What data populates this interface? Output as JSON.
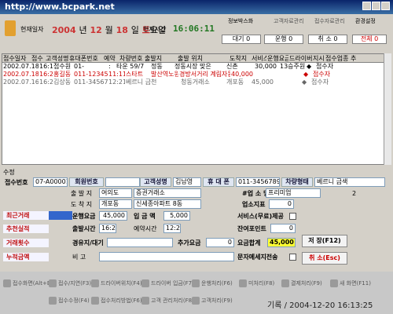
{
  "app": {
    "watermark": "http://www.bcpark.net"
  },
  "header": {
    "current_date_label": "현재일자",
    "date_y": "2004",
    "y": "년",
    "date_m": "12",
    "m": "월",
    "date_d": "18",
    "d": "일",
    "weekday": "토",
    "weekday_suffix": "요일",
    "current_time_label": "현재시간",
    "time": "16:06:11",
    "top_buttons": [
      "정보박스화",
      "고객자료관리",
      "접수자료관리",
      "환경설정"
    ],
    "counts": [
      {
        "label": "대기",
        "value": "0"
      },
      {
        "label": "운행",
        "value": "0"
      },
      {
        "label": "취 소",
        "value": "0"
      },
      {
        "label": "전체",
        "value": "0"
      }
    ]
  },
  "grid": {
    "columns": [
      "접수일자",
      "접수",
      "고객성명",
      "휴대폰번호",
      "예약",
      "차량번호",
      "출발지",
      "출발 위치",
      "도착지",
      "서비스",
      "운행요금",
      "드라이버",
      "지시",
      "접수업종 추가"
    ],
    "rows": [
      {
        "date": "2002.07.18",
        "time": "16:19",
        "person": "접수원",
        "phone": "01-",
        "reserve": "",
        "car": ":",
        "start": "타운 59/7",
        "start2": "정동",
        "location": "정동시장 맞은",
        "dest": "신촌",
        "fee": "30,000",
        "driver": "13승주원",
        "mark": "◆",
        "extra": "접수자"
      },
      {
        "date": "2002.07.18",
        "time": "16:21",
        "person": "홍길동",
        "phone": "011-1234568",
        "reserve": "11:11",
        "car": "스타트",
        "start2": "발산역노원",
        "location": "경방서거리 계림자동",
        "dest": "",
        "fee": "40,000",
        "driver": "",
        "mark": "◆",
        "extra": "접수자"
      },
      {
        "date": "2002.07.16",
        "time": "16:22",
        "person": "김상동",
        "phone": "011-3456789",
        "reserve": "12:21",
        "car": "베르니 금천",
        "start2": "",
        "location": "청동거래소",
        "dest": "개포동",
        "fee": "45,000",
        "driver": "",
        "mark": "◆",
        "extra": "접수자"
      }
    ]
  },
  "form": {
    "section_label": "수정",
    "reception_no_label": "접수번호",
    "reception_no": "07-A00001",
    "member_no_label": "회원번호",
    "customer_name_label": "고객성명",
    "customer_name": "김남영",
    "mobile_label": "휴 대 폰",
    "mobile": "011-3456789",
    "car_type_label": "차량형태",
    "car_type": "베르니 금색",
    "start_label": "출 발 지",
    "start": "여의도",
    "start_loc": "증권거래소",
    "dest_label": "도 착 지",
    "dest": "개포동",
    "dest_loc": "신세종아파트 8동",
    "dispatch_label": "#업 소 명",
    "dispatch": "프리미엄",
    "count_value": "2",
    "driver_label": "오도원",
    "extra_label": "업소지표",
    "extra_value": "0",
    "fare_label": "운행요금",
    "fare": "45,000",
    "deposit_label": "입 금 액",
    "deposit": "5,000",
    "service_label": "서비스(무료)제공",
    "depart_time_label": "출발시간",
    "depart_time": "16:22",
    "reserve_time_label": "예약시간",
    "reserve_time": "12:21",
    "point_label": "잔여포인트",
    "point": "0",
    "route_label": "경유지/대기",
    "surcharge_label": "추가요금",
    "surcharge": "0",
    "total_label": "요금합계",
    "total": "45,000",
    "note_label": "비 고",
    "memo_label": "문자메세지전송",
    "save_button": "저 장(F12)",
    "cancel_button": "취 소(Esc)",
    "side": [
      "최근거래",
      "추천실적",
      "거래횟수",
      "누적금액"
    ]
  },
  "toolbar": {
    "row1": [
      "접수화면(Alt+E)",
      "접수/지연(F3)",
      "드라이버위치(F4)",
      "드라이버 입금(F7)",
      "운행처리(F6)",
      "미처리(F8)",
      "결제처리(F9)",
      "새 화면(F11)"
    ],
    "row2": [
      "",
      "접수수정(F4)",
      "접수처리방법(F6)",
      "고객 관리처리(F8)",
      "고객처리(F9)",
      "",
      "",
      ""
    ],
    "status_time": "기록 / 2004-12-20 16:13:25"
  }
}
